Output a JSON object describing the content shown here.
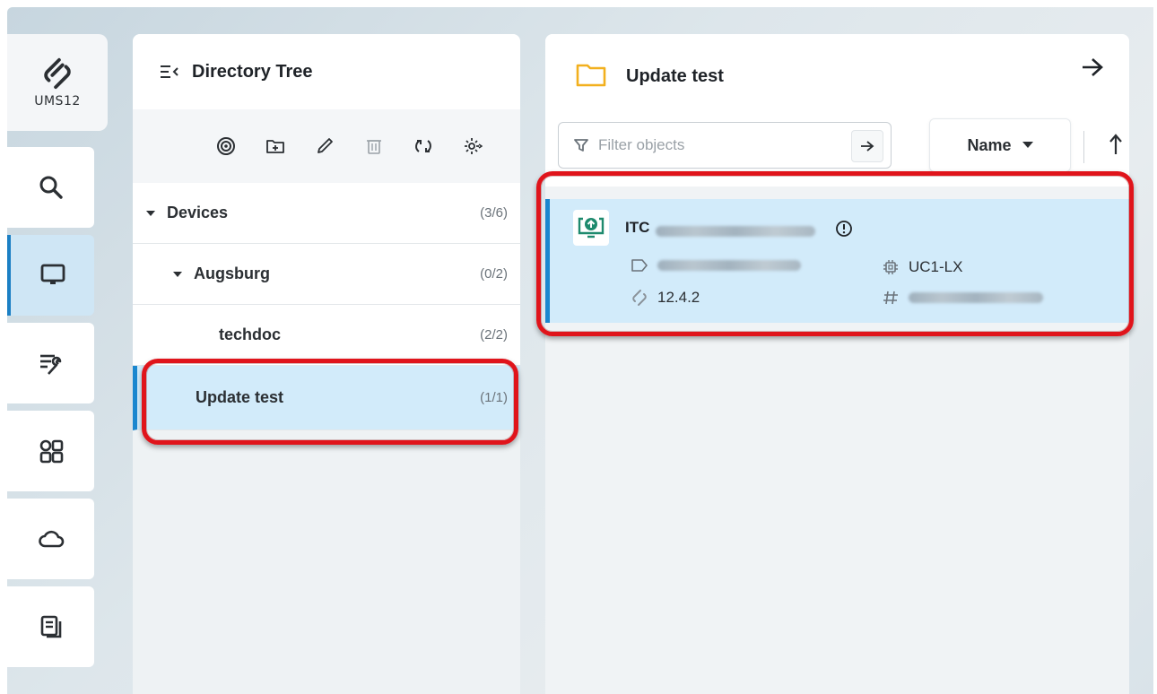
{
  "brand": {
    "logo_icon": "ums-logo-icon",
    "version_label": "UMS12"
  },
  "rail": {
    "items": [
      {
        "id": "search",
        "icon": "search-icon"
      },
      {
        "id": "devices",
        "icon": "monitor-icon",
        "active": true
      },
      {
        "id": "configuration",
        "icon": "list-wrench-icon"
      },
      {
        "id": "apps",
        "icon": "apps-grid-icon"
      },
      {
        "id": "cloud",
        "icon": "cloud-icon"
      },
      {
        "id": "logs",
        "icon": "document-icon"
      }
    ]
  },
  "tree": {
    "title": "Directory Tree",
    "toolbar": [
      "target-icon",
      "new-folder-icon",
      "edit-pencil-icon",
      "delete-trash-icon",
      "refresh-icon",
      "settings-gear-icon"
    ],
    "nodes": [
      {
        "label": "Devices",
        "count": "(3/6)",
        "expanded": true
      },
      {
        "label": "Augsburg",
        "count": "(0/2)",
        "expanded": true
      },
      {
        "label": "techdoc",
        "count": "(2/2)"
      },
      {
        "label": "Update test",
        "count": "(1/1)",
        "selected": true
      }
    ]
  },
  "objects": {
    "title": "Update test",
    "filter": {
      "placeholder": "Filter objects",
      "value": ""
    },
    "sort": {
      "label": "Name"
    },
    "device": {
      "name_prefix": "ITC",
      "firmware": "UC1-LX",
      "version": "12.4.2"
    }
  },
  "colors": {
    "accent": "#1b87cf",
    "selection": "#d2ebfa",
    "annotation": "#e0141b"
  }
}
